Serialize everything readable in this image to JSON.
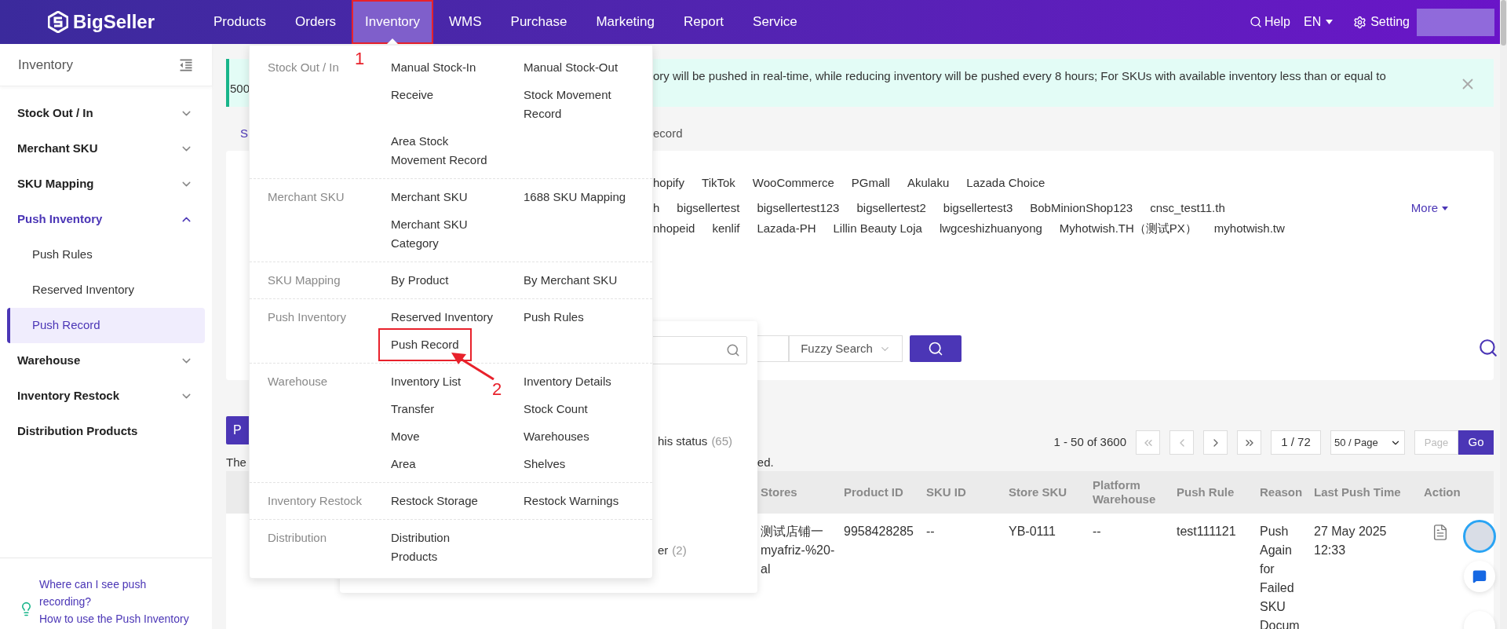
{
  "topbar": {
    "logo": "BigSeller",
    "nav": [
      {
        "label": "Products",
        "selected": false,
        "outlined": false
      },
      {
        "label": "Orders",
        "selected": false,
        "outlined": false
      },
      {
        "label": "Inventory",
        "selected": true,
        "outlined": true
      },
      {
        "label": "WMS",
        "selected": false,
        "outlined": false
      },
      {
        "label": "Purchase",
        "selected": false,
        "outlined": false
      },
      {
        "label": "Marketing",
        "selected": false,
        "outlined": false
      },
      {
        "label": "Report",
        "selected": false,
        "outlined": false
      },
      {
        "label": "Service",
        "selected": false,
        "outlined": false
      }
    ],
    "help": "Help",
    "language": "EN",
    "setting": "Setting"
  },
  "sidebar": {
    "title": "Inventory",
    "items": [
      {
        "label": "Stock Out / In",
        "kind": "group",
        "expanded": false
      },
      {
        "label": "Merchant SKU",
        "kind": "group",
        "expanded": false
      },
      {
        "label": "SKU Mapping",
        "kind": "group",
        "expanded": false
      },
      {
        "label": "Push Inventory",
        "kind": "group",
        "expanded": true,
        "children": [
          {
            "label": "Push Rules",
            "selected": false
          },
          {
            "label": "Reserved Inventory",
            "selected": false
          },
          {
            "label": "Push Record",
            "selected": true
          }
        ]
      },
      {
        "label": "Warehouse",
        "kind": "group",
        "expanded": false
      },
      {
        "label": "Inventory Restock",
        "kind": "group",
        "expanded": false
      },
      {
        "label": "Distribution Products",
        "kind": "link"
      }
    ],
    "help_links": [
      "Where can I see push recording?",
      "How to use the Push Inventory"
    ]
  },
  "notice": {
    "line_1": "ory will be pushed in real-time, while reducing inventory will be pushed every 8 hours; For SKUs with available inventory less than or equal to",
    "line_2": "500"
  },
  "tabs": [
    {
      "label": "S",
      "selected": true
    },
    {
      "label": "ecord",
      "selected": false
    }
  ],
  "filters": {
    "platforms": [
      "hopify",
      "TikTok",
      "WooCommerce",
      "PGmall",
      "Akulaku",
      "Lazada Choice"
    ],
    "stores_line_1": [
      "h",
      "bigsellertest",
      "bigsellertest123",
      "bigsellertest2",
      "bigsellertest3",
      "BobMinionShop123",
      "cnsc_test11.th"
    ],
    "stores_line_2": [
      "nhopeid",
      "kenlif",
      "Lazada-PH",
      "Lillin Beauty Loja",
      "lwgceshizhuanyong",
      "Myhotwish.TH（测试PX）",
      "myhotwish.tw"
    ],
    "more": "More",
    "match_mode": "Fuzzy Search"
  },
  "store_dropdown": {
    "options": [
      {
        "label": "his status",
        "count": "(65)"
      },
      {
        "label": "er",
        "count": "(2)"
      }
    ]
  },
  "toolbar": {
    "button": "P",
    "note_start": "The",
    "note_end": "ed.",
    "range": "1 - 50 of 3600",
    "page": "1 / 72",
    "page_size": "50 / Page",
    "page_placeholder": "Page",
    "go": "Go"
  },
  "table": {
    "columns": [
      "Stores",
      "Product ID",
      "SKU ID",
      "Store SKU",
      "Platform Warehouse",
      "Push Rule",
      "Reason",
      "Last Push Time",
      "Action"
    ],
    "rows": [
      {
        "cells": [
          "测试店铺一 myafriz-%20-al",
          "9958428285",
          "--",
          "YB-0111",
          "--",
          "test111121",
          "Push Again for Failed SKU Docum",
          "27 May 2025 12:33"
        ]
      }
    ]
  },
  "mega_menu": [
    {
      "label": "Stock Out / In",
      "items": [
        {
          "label": "Manual Stock-In",
          "outlined": false
        },
        {
          "label": "Manual Stock-Out",
          "outlined": false
        },
        {
          "label": "Receive",
          "outlined": false
        },
        {
          "label": "Stock Movement Record",
          "outlined": false
        },
        {
          "label": "Area Stock Movement Record",
          "outlined": false
        }
      ]
    },
    {
      "label": "Merchant SKU",
      "items": [
        {
          "label": "Merchant SKU",
          "outlined": false
        },
        {
          "label": "1688 SKU Mapping",
          "outlined": false
        },
        {
          "label": "Merchant SKU Category",
          "outlined": false
        }
      ]
    },
    {
      "label": "SKU Mapping",
      "items": [
        {
          "label": "By Product",
          "outlined": false
        },
        {
          "label": "By Merchant SKU",
          "outlined": false
        }
      ]
    },
    {
      "label": "Push Inventory",
      "items": [
        {
          "label": "Reserved Inventory",
          "outlined": false
        },
        {
          "label": "Push Rules",
          "outlined": false
        },
        {
          "label": "Push Record",
          "outlined": true
        }
      ]
    },
    {
      "label": "Warehouse",
      "items": [
        {
          "label": "Inventory List",
          "outlined": false
        },
        {
          "label": "Inventory Details",
          "outlined": false
        },
        {
          "label": "Transfer",
          "outlined": false
        },
        {
          "label": "Stock Count",
          "outlined": false
        },
        {
          "label": "Move",
          "outlined": false
        },
        {
          "label": "Warehouses",
          "outlined": false
        },
        {
          "label": "Area",
          "outlined": false
        },
        {
          "label": "Shelves",
          "outlined": false
        }
      ]
    },
    {
      "label": "Inventory Restock",
      "items": [
        {
          "label": "Restock Storage",
          "outlined": false
        },
        {
          "label": "Restock Warnings",
          "outlined": false
        }
      ]
    },
    {
      "label": "Distribution",
      "items": [
        {
          "label": "Distribution Products",
          "outlined": false
        }
      ]
    }
  ],
  "annotations": [
    "1",
    "2"
  ]
}
